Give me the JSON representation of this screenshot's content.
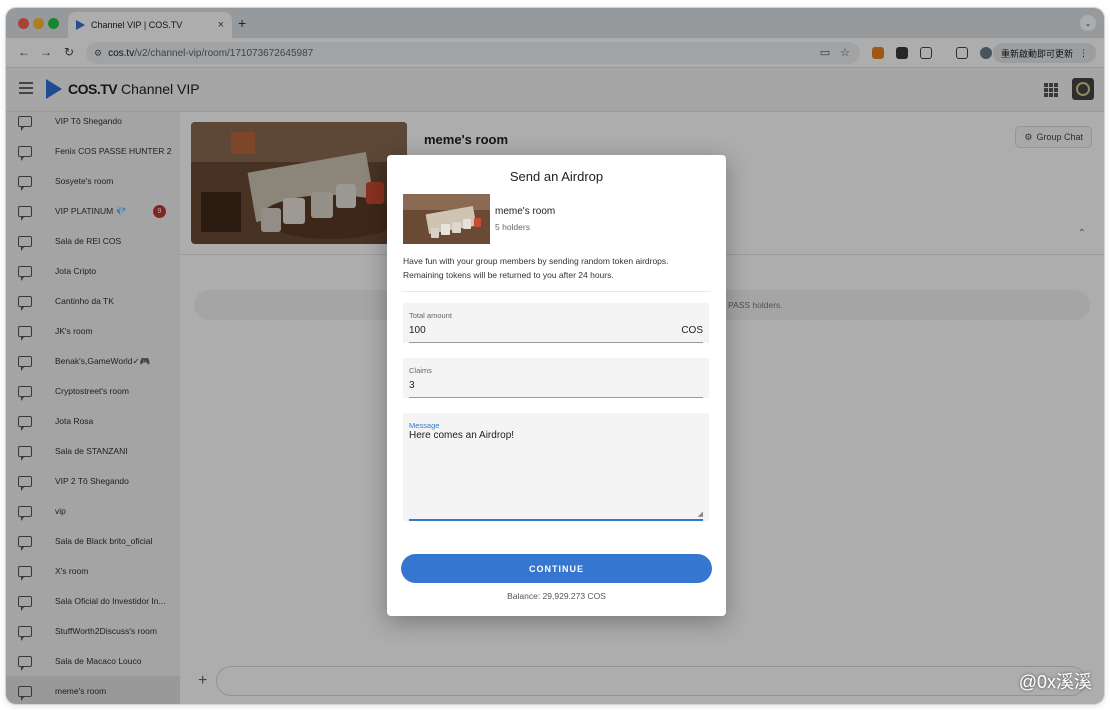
{
  "browser": {
    "tab_title": "Channel VIP | COS.TV",
    "tab_close": "×",
    "new_tab": "+",
    "url_host": "cos.tv",
    "url_path": "/v2/channel-vip/room/171073672645987",
    "update_button": "重新啟動即可更新"
  },
  "header": {
    "brand_bold": "COS.TV",
    "brand_rest": " Channel VIP"
  },
  "sidebar": {
    "items": [
      {
        "label": "VIP Tô Shegando"
      },
      {
        "label": "Fenix COS PASSE HUNTER 2"
      },
      {
        "label": "Sosyete's room"
      },
      {
        "label": "VIP PLATINUM 💎",
        "badge": "9"
      },
      {
        "label": "Sala de REI COS"
      },
      {
        "label": "Jota Cripto"
      },
      {
        "label": "Cantinho da TK"
      },
      {
        "label": "JK's room"
      },
      {
        "label": "Benak's,GameWorld✓🎮"
      },
      {
        "label": "Cryptostreet's room"
      },
      {
        "label": "Jota Rosa"
      },
      {
        "label": "Sala de STANZANI"
      },
      {
        "label": "VIP 2 Tô Shegando"
      },
      {
        "label": "vip"
      },
      {
        "label": "Sala de Black brito_oficial"
      },
      {
        "label": "X's room"
      },
      {
        "label": "Sala Oficial do Investidor In..."
      },
      {
        "label": "StuffWorth2Discuss's room"
      },
      {
        "label": "Sala de Macaco Louco"
      },
      {
        "label": "meme's room"
      }
    ]
  },
  "main": {
    "room_title": "meme's room",
    "group_chat": "Group Chat",
    "holders_note": "PASS holders."
  },
  "modal": {
    "title": "Send an Airdrop",
    "room_name": "meme's room",
    "holders": "5 holders",
    "description": "Have fun with your group members by sending random token airdrops. Remaining tokens will be returned to you after 24 hours.",
    "total_amount": {
      "label": "Total amount",
      "value": "100",
      "suffix": "COS"
    },
    "claims": {
      "label": "Claims",
      "value": "3"
    },
    "message": {
      "label": "Message",
      "value": "Here comes an Airdrop!"
    },
    "continue_label": "CONTINUE",
    "balance": "Balance: 29,929.273 COS"
  },
  "watermark": "@0x溪溪",
  "colors": {
    "accent": "#3577d0",
    "badge": "#c0392b",
    "brand": "#2f6fd8"
  }
}
